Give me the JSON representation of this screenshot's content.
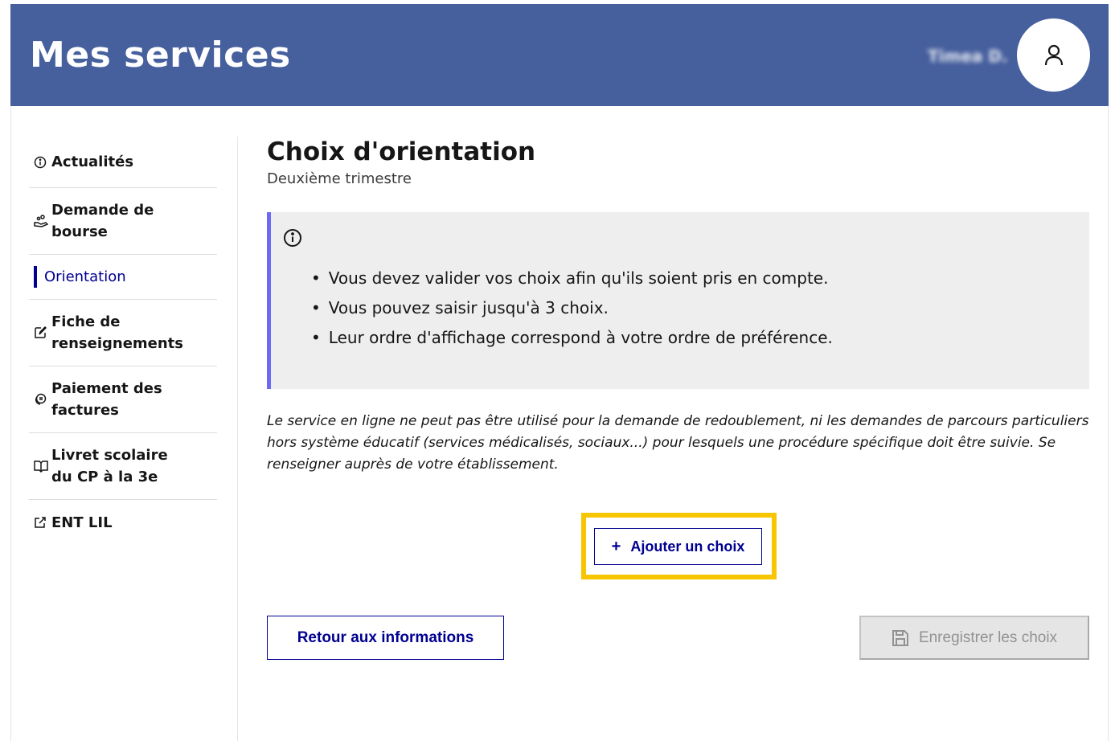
{
  "header": {
    "app_title": "Mes services",
    "user_name": "Timea D."
  },
  "sidebar": {
    "items": [
      {
        "label": "Actualités",
        "icon": "info-icon"
      },
      {
        "label": "Demande de bourse",
        "icon": "hand-coins-icon"
      },
      {
        "label": "Orientation",
        "icon": "",
        "active": true
      },
      {
        "label": "Fiche de renseignements",
        "icon": "edit-icon"
      },
      {
        "label": "Paiement des factures",
        "icon": "coins-icon"
      },
      {
        "label": "Livret scolaire du CP à la 3e",
        "icon": "book-icon"
      },
      {
        "label": "ENT LIL",
        "icon": "external-link-icon"
      }
    ]
  },
  "main": {
    "title": "Choix d'orientation",
    "subtitle": "Deuxième trimestre",
    "info_items": [
      "Vous devez valider vos choix afin qu'ils soient pris en compte.",
      "Vous pouvez saisir jusqu'à 3 choix.",
      "Leur ordre d'affichage correspond à votre ordre de préférence."
    ],
    "notice": "Le service en ligne ne peut pas être utilisé pour la demande de redoublement, ni les demandes de parcours particuliers hors système éducatif (services médicalisés, sociaux...) pour lesquels une procédure spécifique doit être suivie. Se renseigner auprès de votre établissement.",
    "add_choice_label": "Ajouter un choix",
    "back_label": "Retour aux informations",
    "save_label": "Enregistrer les choix"
  },
  "colors": {
    "header_bg": "#465f9d",
    "primary": "#000091",
    "info_accent": "#6a6af4",
    "highlight": "#f7c600",
    "disabled_bg": "#e5e5e5"
  }
}
